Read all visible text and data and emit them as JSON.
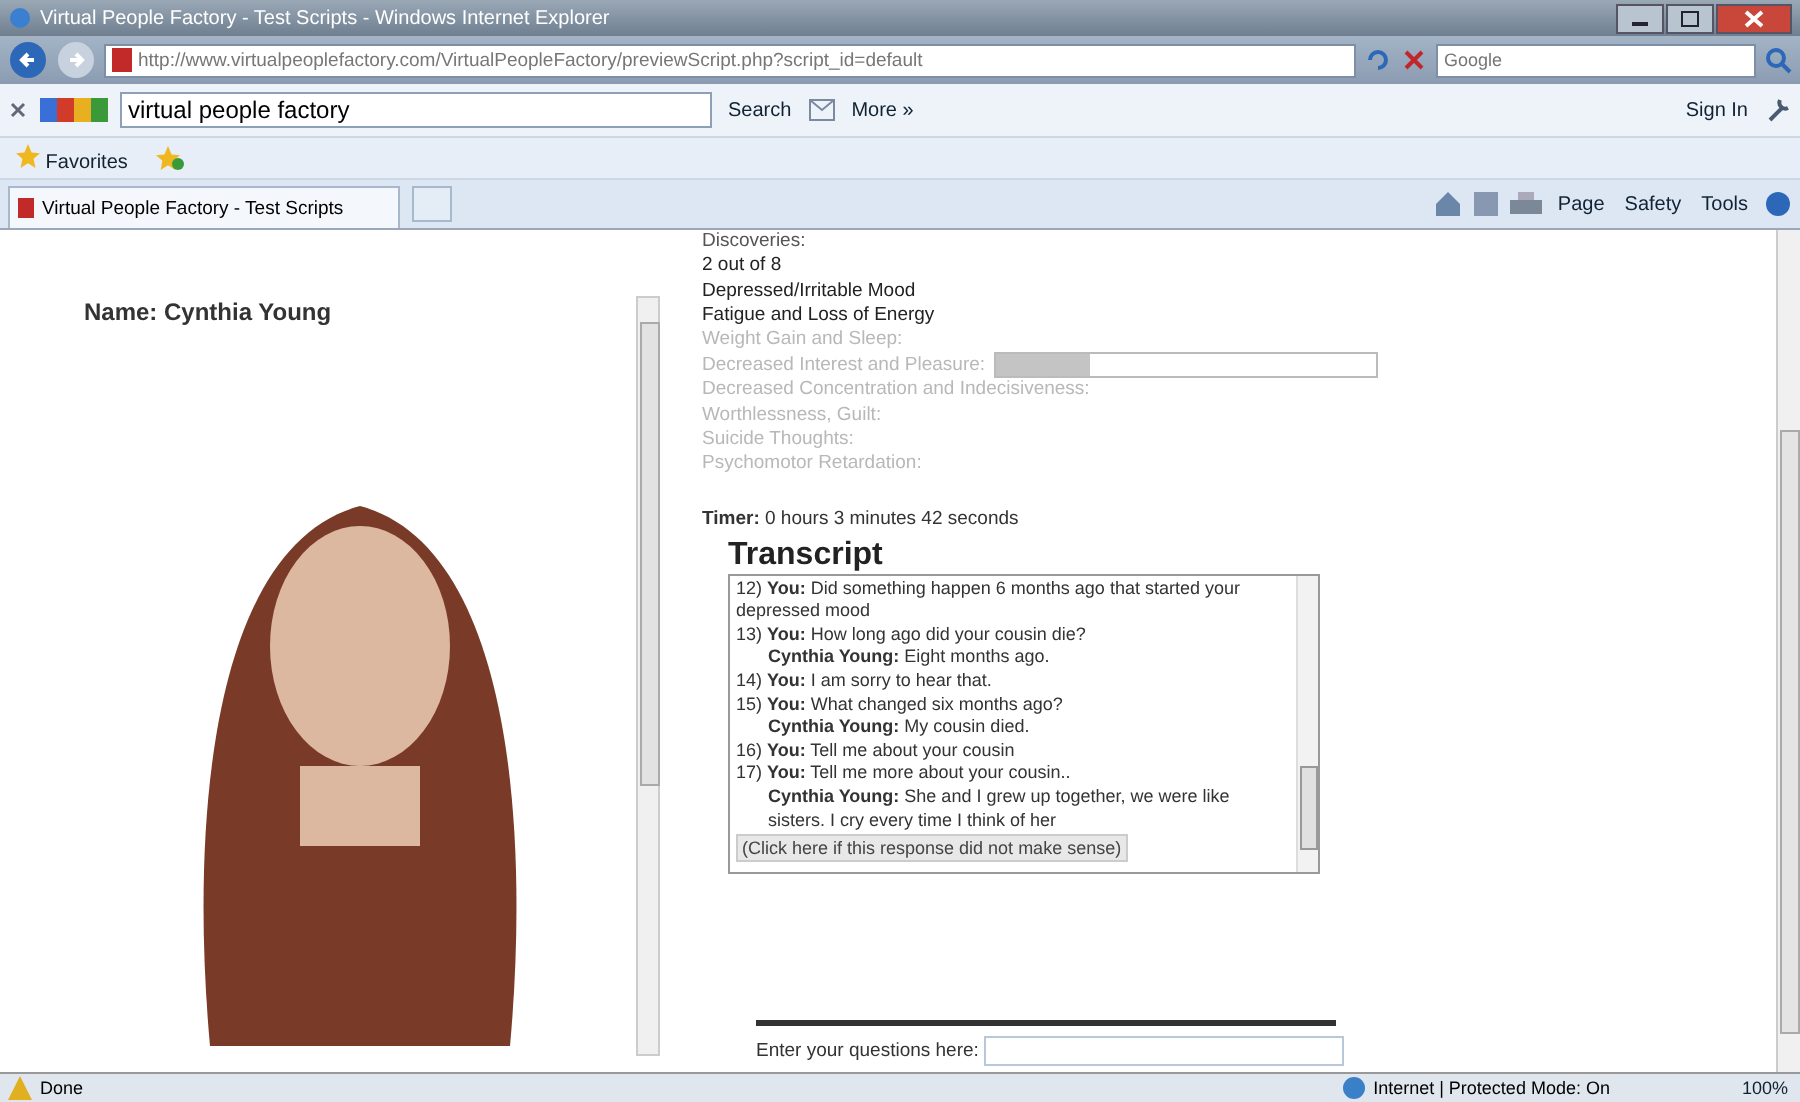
{
  "window": {
    "title": "Virtual People Factory - Test Scripts - Windows Internet Explorer"
  },
  "address_bar": {
    "url": "http://www.virtualpeoplefactory.com/VirtualPeopleFactory/previewScript.php?script_id=default",
    "search_placeholder": "Google"
  },
  "google_toolbar": {
    "query": "virtual people factory",
    "search_label": "Search",
    "more_label": "More »",
    "sign_in": "Sign In"
  },
  "favorites_bar": {
    "label": "Favorites"
  },
  "tabs": [
    {
      "label": "Virtual People Factory - Test Scripts",
      "selected": true
    }
  ],
  "command_bar": [
    "Page",
    "Safety",
    "Tools"
  ],
  "character": {
    "name": "Name: Cynthia Young"
  },
  "discoveries": {
    "heading": "Discoveries:",
    "count": "2 out of 8",
    "items": [
      {
        "label": "Depressed/Irritable Mood",
        "found": true
      },
      {
        "label": "Fatigue and Loss of Energy",
        "found": true
      },
      {
        "label": "Weight Gain and Sleep:",
        "found": false
      },
      {
        "label": "Decreased Interest and Pleasure:",
        "found": false
      },
      {
        "label": "Decreased Concentration and Indecisiveness:",
        "found": false
      },
      {
        "label": "Worthlessness, Guilt:",
        "found": false
      },
      {
        "label": "Suicide Thoughts:",
        "found": false
      },
      {
        "label": "Psychomotor Retardation:",
        "found": false
      }
    ],
    "loading": {
      "level": 0.25
    }
  },
  "timer": {
    "label": "Timer:",
    "value": "0 hours 3 minutes 42 seconds"
  },
  "transcript": {
    "title": "Transcript",
    "entries": [
      {
        "kind": "user",
        "number": "12)",
        "speaker": "You:",
        "text": "Did something happen 6 months ago that started your depressed mood"
      },
      {
        "kind": "user",
        "number": "13)",
        "speaker": "You:",
        "text": "How long ago did your cousin die?"
      },
      {
        "kind": "character",
        "speaker": "Cynthia Young:",
        "text": "Eight months ago."
      },
      {
        "kind": "user",
        "number": "14)",
        "speaker": "You:",
        "text": "I am sorry to hear that."
      },
      {
        "kind": "user",
        "number": "15)",
        "speaker": "You:",
        "text": "What changed six months ago?"
      },
      {
        "kind": "character",
        "speaker": "Cynthia Young:",
        "text": "My cousin died."
      },
      {
        "kind": "user",
        "number": "16)",
        "speaker": "You:",
        "text": "Tell me about your cousin"
      },
      {
        "kind": "user",
        "number": "17)",
        "speaker": "You:",
        "text": "Tell me more about your cousin.."
      },
      {
        "kind": "character",
        "speaker": "Cynthia Young:",
        "text": "She and I grew up together, we were like sisters. I cry every time I think of her"
      }
    ],
    "feedback_button": "(Click here if this response did not make sense)"
  },
  "question": {
    "label": "Enter your questions here:"
  },
  "status_bar": {
    "status": "Done",
    "zone": "Internet | Protected Mode: On",
    "zoom": "100%"
  }
}
